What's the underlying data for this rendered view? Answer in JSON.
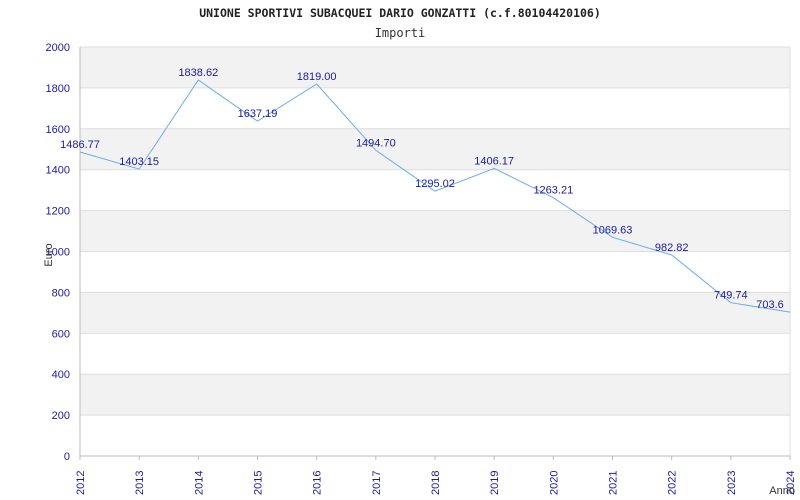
{
  "chart_data": {
    "type": "line",
    "title": "UNIONE SPORTIVI SUBACQUEI DARIO GONZATTI (c.f.80104420106)",
    "subtitle": "Importi",
    "xlabel": "Anno",
    "ylabel": "Euro",
    "x": [
      "2012",
      "2013",
      "2014",
      "2015",
      "2016",
      "2017",
      "2018",
      "2019",
      "2020",
      "2021",
      "2022",
      "2023",
      "2024"
    ],
    "y": [
      1486.77,
      1403.15,
      1838.62,
      1637.19,
      1819.0,
      1494.7,
      1295.02,
      1406.17,
      1263.21,
      1069.63,
      982.82,
      749.74,
      703.6
    ],
    "data_labels": [
      "1486.77",
      "1403.15",
      "1838.62",
      "1637.19",
      "1819.00",
      "1494.70",
      "1295.02",
      "1406.17",
      "1263.21",
      "1069.63",
      "982.82",
      "749.74",
      "703.6"
    ],
    "ylim": [
      0,
      2000
    ],
    "yticks": [
      "0",
      "200",
      "400",
      "600",
      "800",
      "1000",
      "1200",
      "1400",
      "1600",
      "1800",
      "2000"
    ],
    "grid": true,
    "legend": "none",
    "colors": {
      "line": "#6aaee8",
      "band": "#f2f2f2",
      "gridline": "#dddddd",
      "axis_text": "#1a1aa0",
      "data_label": "#1a1aa0",
      "title_text": "#222222"
    }
  }
}
